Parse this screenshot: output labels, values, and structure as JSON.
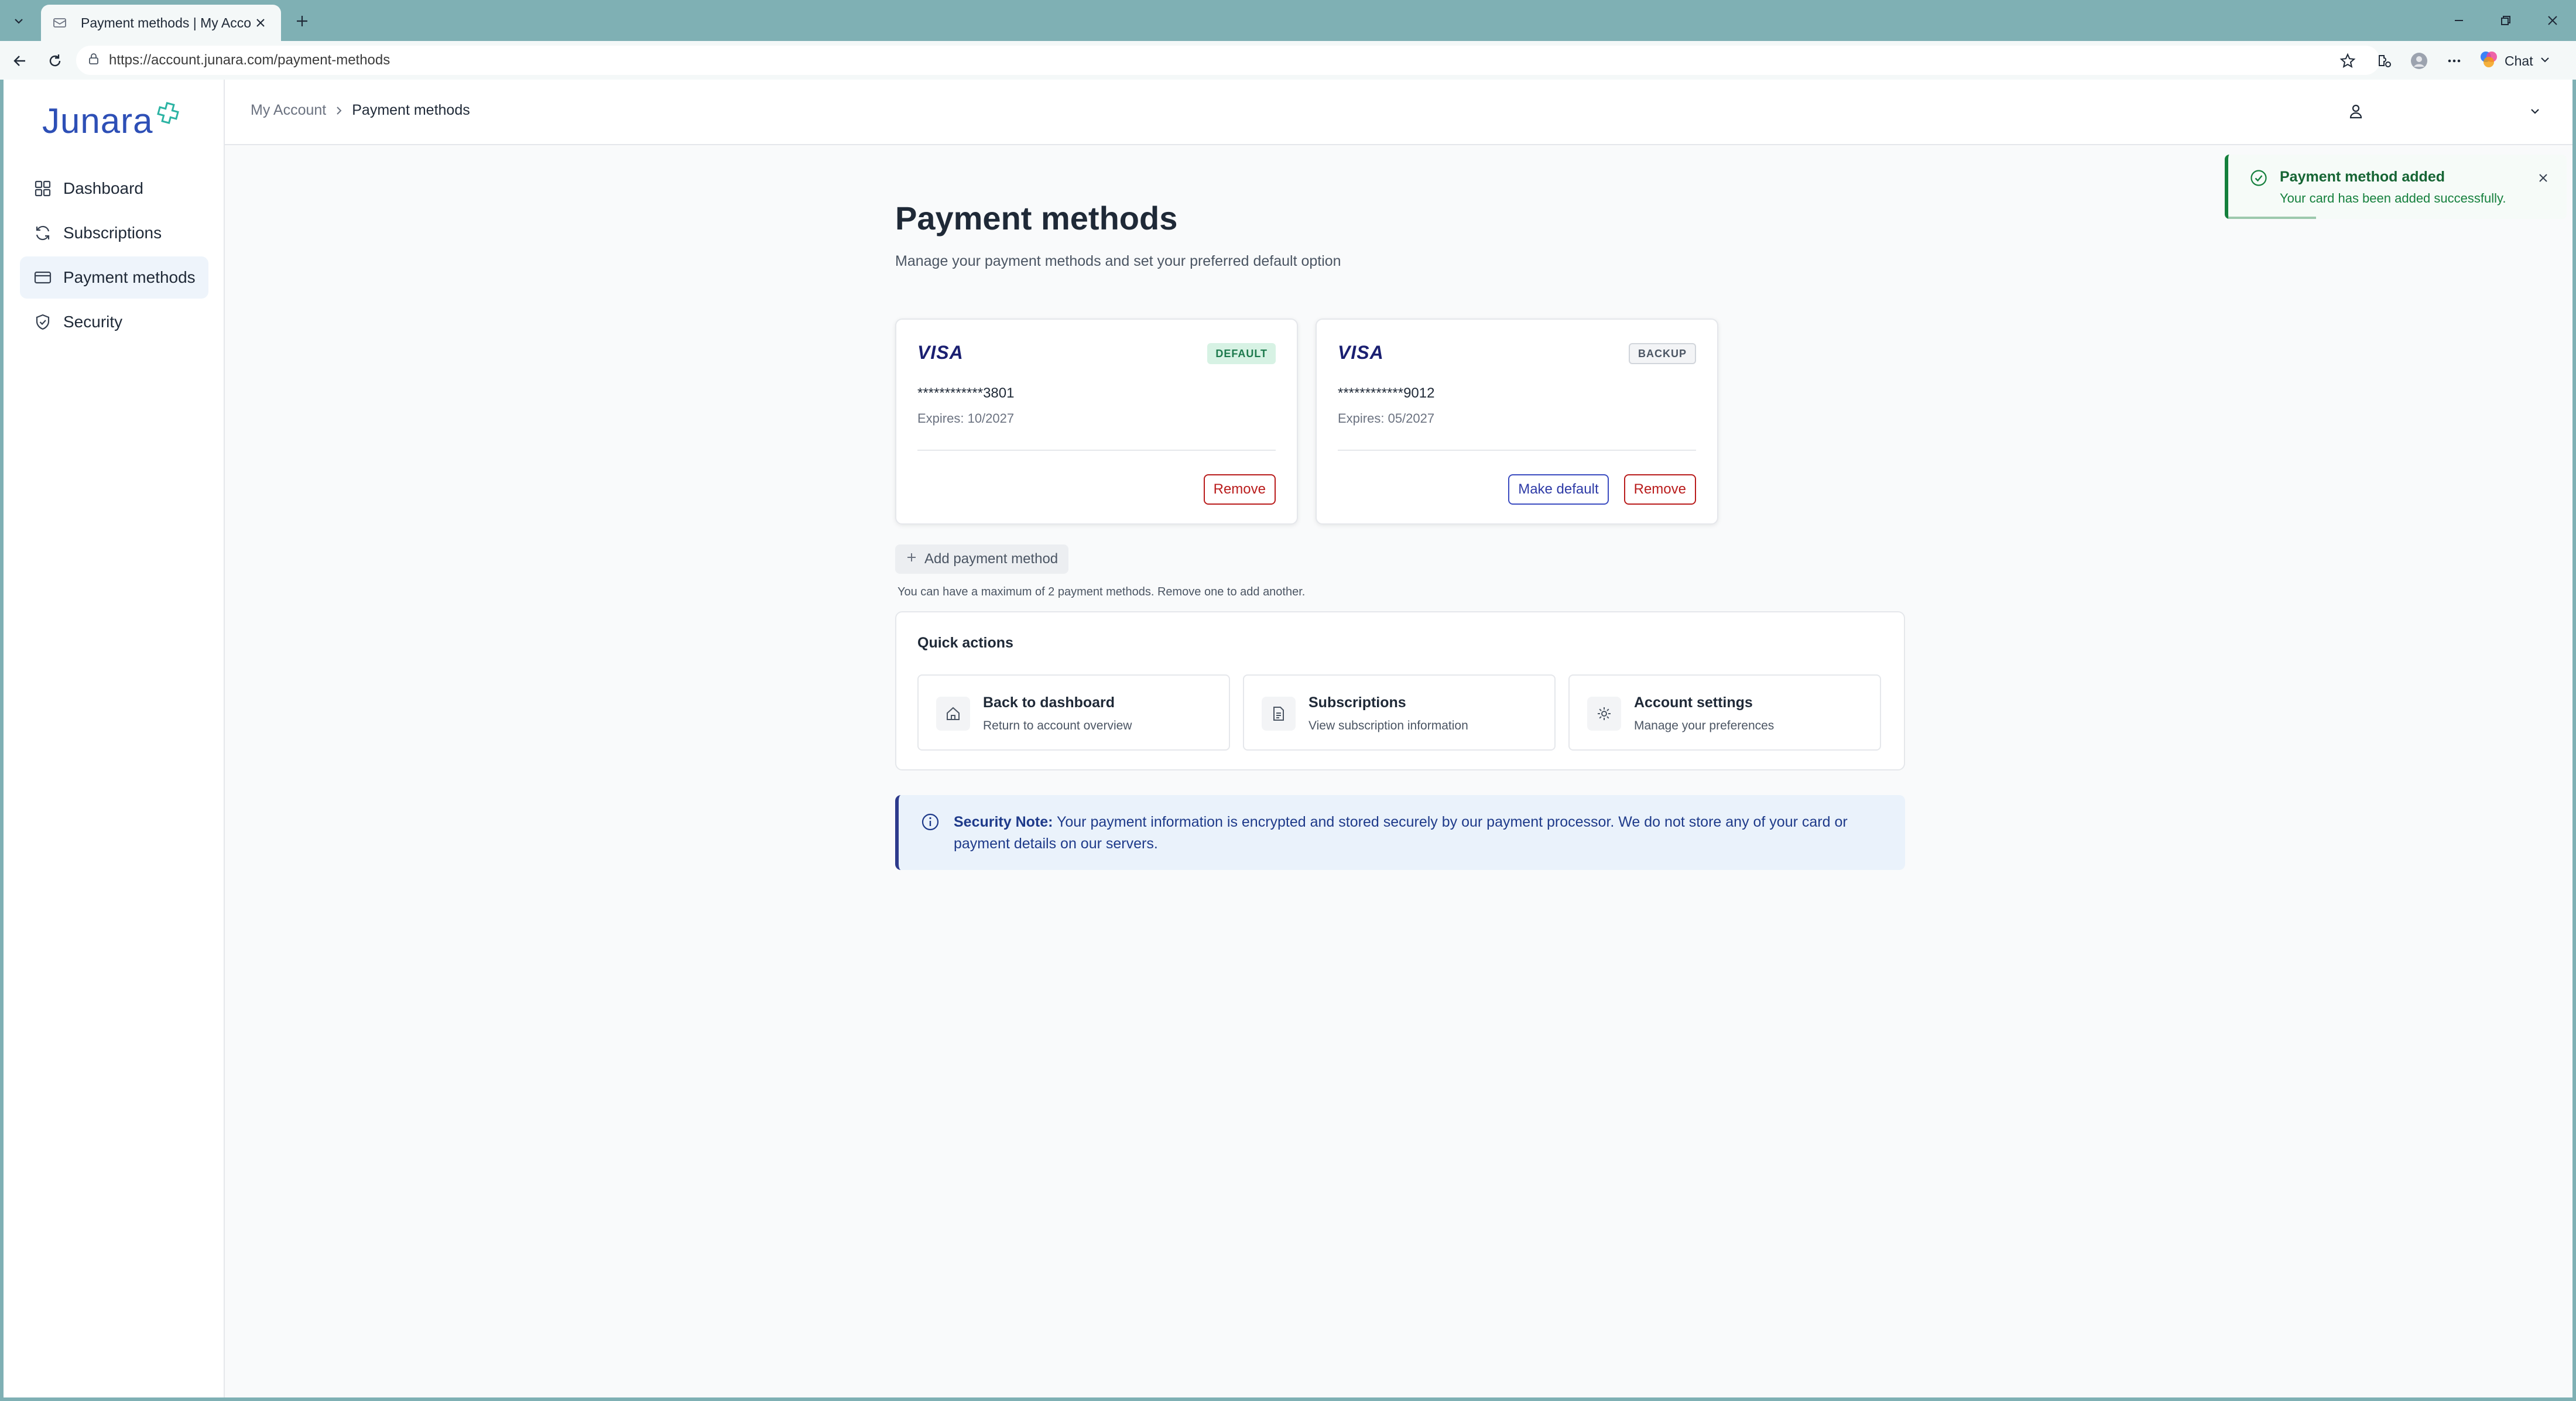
{
  "browser": {
    "tab_title": "Payment methods | My Account",
    "url": "https://account.junara.com/payment-methods",
    "chat_label": "Chat"
  },
  "brand": {
    "logo_text": "Junara",
    "accent": "#2d4fb6"
  },
  "sidebar": {
    "items": [
      {
        "label": "Dashboard",
        "icon": "grid-icon",
        "active": false
      },
      {
        "label": "Subscriptions",
        "icon": "refresh-icon",
        "active": false
      },
      {
        "label": "Payment methods",
        "icon": "credit-card-icon",
        "active": true
      },
      {
        "label": "Security",
        "icon": "shield-icon",
        "active": false
      }
    ]
  },
  "breadcrumb": {
    "parent": "My Account",
    "current": "Payment methods"
  },
  "page": {
    "title": "Payment methods",
    "subtitle": "Manage your payment methods and set your preferred default option"
  },
  "cards": [
    {
      "brand": "VISA",
      "badge": "DEFAULT",
      "number": "************3801",
      "expires": "Expires: 10/2027",
      "actions": {
        "remove": "Remove"
      }
    },
    {
      "brand": "VISA",
      "badge": "BACKUP",
      "number": "************9012",
      "expires": "Expires: 05/2027",
      "actions": {
        "make_default": "Make default",
        "remove": "Remove"
      }
    }
  ],
  "add_payment": {
    "label": "Add payment method",
    "limit_note": "You can have a maximum of 2 payment methods. Remove one to add another."
  },
  "quick_actions": {
    "title": "Quick actions",
    "items": [
      {
        "title": "Back to dashboard",
        "desc": "Return to account overview",
        "icon": "home-icon"
      },
      {
        "title": "Subscriptions",
        "desc": "View subscription information",
        "icon": "document-icon"
      },
      {
        "title": "Account settings",
        "desc": "Manage your preferences",
        "icon": "gear-icon"
      }
    ]
  },
  "security_note": {
    "label": "Security Note:",
    "text": "Your payment information is encrypted and stored securely by our payment processor. We do not store any of your card or payment details on our servers."
  },
  "toast": {
    "title": "Payment method added",
    "message": "Your card has been added successfully.",
    "progress": 0.26,
    "color": "#15803d"
  }
}
